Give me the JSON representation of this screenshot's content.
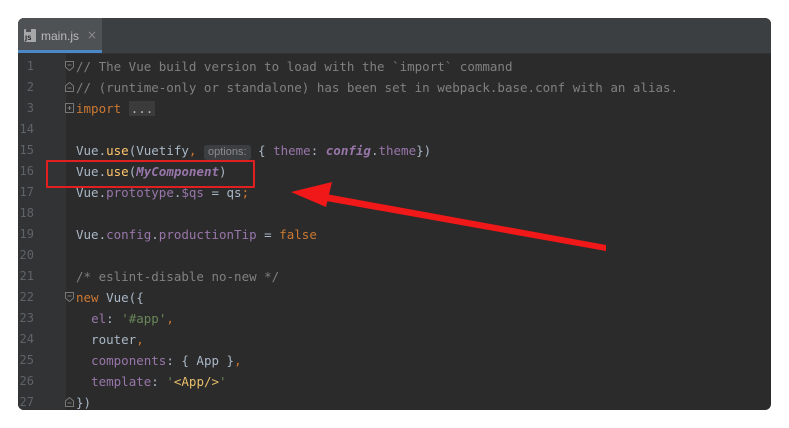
{
  "tab": {
    "icon": "js-file-icon",
    "icon_text": "JS",
    "label": "main.js",
    "close": "×"
  },
  "lines": [
    {
      "num": "1",
      "fold": "start",
      "segments": [
        {
          "c": "comment",
          "t": "// The Vue build version to load with the `import` command"
        }
      ]
    },
    {
      "num": "2",
      "fold": "end",
      "segments": [
        {
          "c": "comment",
          "t": "// (runtime-only or standalone) has been set in webpack.base.conf with an alias."
        }
      ]
    },
    {
      "num": "3",
      "fold": "plus",
      "segments": [
        {
          "c": "kw",
          "t": "import "
        },
        {
          "c": "folded",
          "t": "..."
        }
      ]
    },
    {
      "num": "14",
      "fold": "",
      "segments": []
    },
    {
      "num": "15",
      "fold": "",
      "segments": [
        {
          "c": "plain",
          "t": "Vue."
        },
        {
          "c": "fn",
          "t": "use"
        },
        {
          "c": "plain",
          "t": "(Vuetify"
        },
        {
          "c": "kw",
          "t": ", "
        },
        {
          "c": "hint",
          "t": "options:"
        },
        {
          "c": "plain",
          "t": " { "
        },
        {
          "c": "prop",
          "t": "theme"
        },
        {
          "c": "plain",
          "t": ": "
        },
        {
          "c": "ital-prop",
          "t": "config"
        },
        {
          "c": "plain",
          "t": "."
        },
        {
          "c": "prop",
          "t": "theme"
        },
        {
          "c": "plain",
          "t": "})"
        }
      ]
    },
    {
      "num": "16",
      "fold": "",
      "segments": [
        {
          "c": "plain",
          "t": "Vue."
        },
        {
          "c": "fn",
          "t": "use"
        },
        {
          "c": "plain",
          "t": "("
        },
        {
          "c": "ital-prop",
          "t": "MyComponent"
        },
        {
          "c": "plain",
          "t": ")"
        }
      ]
    },
    {
      "num": "17",
      "fold": "",
      "segments": [
        {
          "c": "plain",
          "t": "Vue."
        },
        {
          "c": "prop",
          "t": "prototype"
        },
        {
          "c": "plain",
          "t": "."
        },
        {
          "c": "prop",
          "t": "$qs"
        },
        {
          "c": "plain",
          "t": " = qs"
        },
        {
          "c": "kw",
          "t": ";"
        }
      ]
    },
    {
      "num": "18",
      "fold": "",
      "segments": []
    },
    {
      "num": "19",
      "fold": "",
      "segments": [
        {
          "c": "plain",
          "t": "Vue."
        },
        {
          "c": "prop",
          "t": "config"
        },
        {
          "c": "plain",
          "t": "."
        },
        {
          "c": "prop",
          "t": "productionTip"
        },
        {
          "c": "plain",
          "t": " = "
        },
        {
          "c": "kw",
          "t": "false"
        }
      ]
    },
    {
      "num": "20",
      "fold": "",
      "segments": []
    },
    {
      "num": "21",
      "fold": "",
      "segments": [
        {
          "c": "comment",
          "t": "/* eslint-disable no-new */"
        }
      ]
    },
    {
      "num": "22",
      "fold": "start",
      "segments": [
        {
          "c": "kw",
          "t": "new "
        },
        {
          "c": "plain",
          "t": "Vue({"
        }
      ]
    },
    {
      "num": "23",
      "fold": "",
      "segments": [
        {
          "c": "plain",
          "t": "  "
        },
        {
          "c": "prop",
          "t": "el"
        },
        {
          "c": "plain",
          "t": ": "
        },
        {
          "c": "str",
          "t": "'#app'"
        },
        {
          "c": "kw",
          "t": ","
        }
      ]
    },
    {
      "num": "24",
      "fold": "",
      "segments": [
        {
          "c": "plain",
          "t": "  router"
        },
        {
          "c": "kw",
          "t": ","
        }
      ]
    },
    {
      "num": "25",
      "fold": "",
      "segments": [
        {
          "c": "plain",
          "t": "  "
        },
        {
          "c": "prop",
          "t": "components"
        },
        {
          "c": "plain",
          "t": ": { App }"
        },
        {
          "c": "kw",
          "t": ","
        }
      ]
    },
    {
      "num": "26",
      "fold": "",
      "segments": [
        {
          "c": "plain",
          "t": "  "
        },
        {
          "c": "prop",
          "t": "template"
        },
        {
          "c": "plain",
          "t": ": "
        },
        {
          "c": "str",
          "t": "'"
        },
        {
          "c": "tag",
          "t": "<App/>"
        },
        {
          "c": "str",
          "t": "'"
        }
      ]
    },
    {
      "num": "27",
      "fold": "end",
      "segments": [
        {
          "c": "plain",
          "t": "})"
        }
      ]
    }
  ],
  "annotation": {
    "box_color": "#e02020",
    "arrow_color": "#f01818",
    "target_line": "17"
  },
  "colors": {
    "editor_bg": "#2b2b2b",
    "gutter_bg": "#313335",
    "keyword": "#cc7832",
    "string": "#6a8759",
    "property": "#9876aa",
    "function": "#ffc66d",
    "comment": "#808080"
  }
}
